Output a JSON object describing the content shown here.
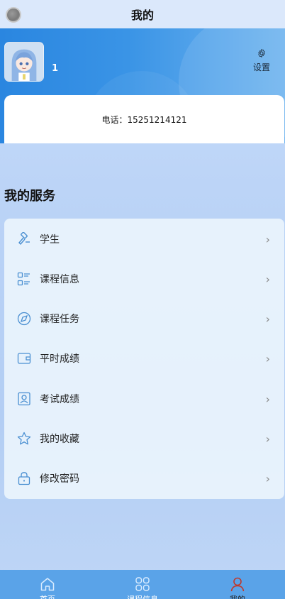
{
  "header": {
    "title": "我的"
  },
  "profile": {
    "username": "1",
    "settings_label": "设置"
  },
  "contact": {
    "phone_text": "电话：15251214121"
  },
  "services": {
    "title": "我的服务",
    "items": [
      {
        "label": "学生",
        "icon": "hammer-icon"
      },
      {
        "label": "课程信息",
        "icon": "list-icon"
      },
      {
        "label": "课程任务",
        "icon": "compass-icon"
      },
      {
        "label": "平时成绩",
        "icon": "wallet-icon"
      },
      {
        "label": "考试成绩",
        "icon": "id-card-icon"
      },
      {
        "label": "我的收藏",
        "icon": "star-icon"
      },
      {
        "label": "修改密码",
        "icon": "lock-icon"
      }
    ],
    "chevron": "›"
  },
  "tabbar": {
    "tabs": [
      {
        "label": "首页",
        "icon": "home-icon"
      },
      {
        "label": "课程信息",
        "icon": "grid-icon"
      },
      {
        "label": "我的",
        "icon": "user-icon",
        "active": true
      }
    ]
  },
  "colors": {
    "primary": "#2a86e0",
    "icon_blue": "#4a8fd1",
    "active_tab": "#c0392b"
  }
}
